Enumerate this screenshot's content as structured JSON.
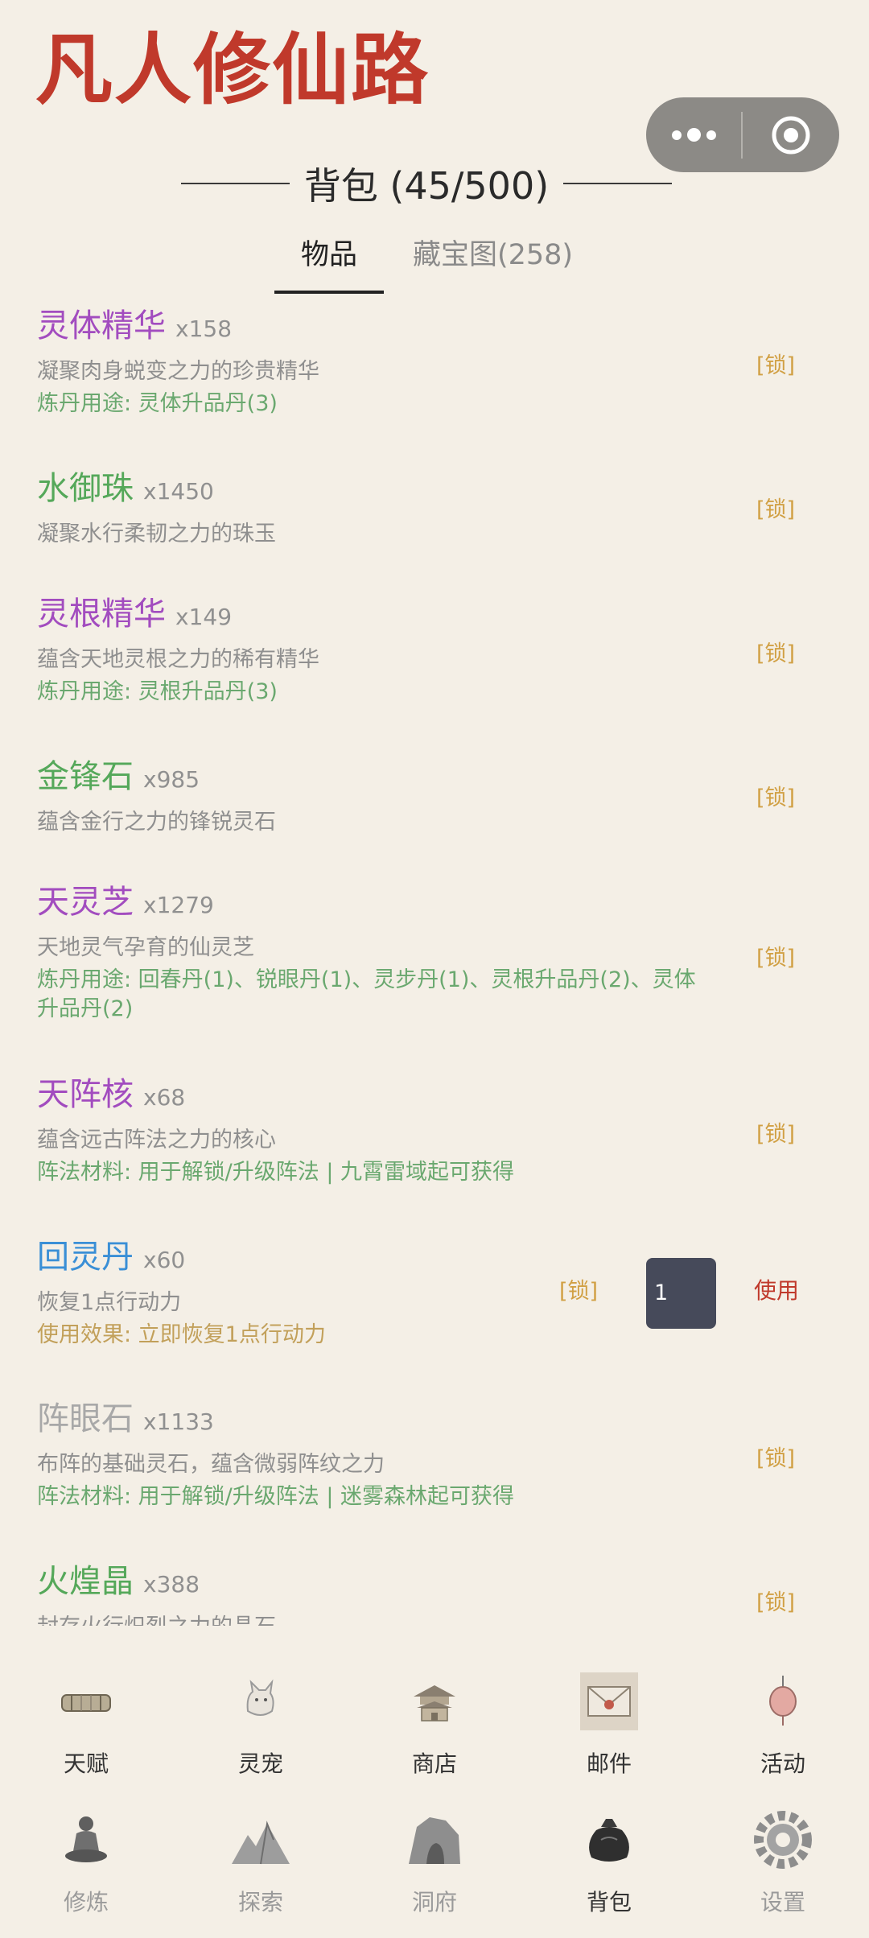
{
  "app": {
    "title": "凡人修仙路"
  },
  "header": {
    "section_title": "背包 (45/500)"
  },
  "tabs": [
    {
      "label": "物品",
      "active": true
    },
    {
      "label": "藏宝图(258)",
      "active": false
    }
  ],
  "items": [
    {
      "name": "灵体精华",
      "color": "#a24cbf",
      "count": "x158",
      "desc": "凝聚肉身蜕变之力的珍贵精华",
      "extra": "炼丹用途: 灵体升品丹(3)",
      "lock": "[锁]"
    },
    {
      "name": "水御珠",
      "color": "#55a85a",
      "count": "x1450",
      "desc": "凝聚水行柔韧之力的珠玉",
      "extra": "",
      "lock": "[锁]"
    },
    {
      "name": "灵根精华",
      "color": "#a24cbf",
      "count": "x149",
      "desc": "蕴含天地灵根之力的稀有精华",
      "extra": "炼丹用途: 灵根升品丹(3)",
      "lock": "[锁]"
    },
    {
      "name": "金锋石",
      "color": "#55a85a",
      "count": "x985",
      "desc": "蕴含金行之力的锋锐灵石",
      "extra": "",
      "lock": "[锁]"
    },
    {
      "name": "天灵芝",
      "color": "#a24cbf",
      "count": "x1279",
      "desc": "天地灵气孕育的仙灵芝",
      "extra": "炼丹用途: 回春丹(1)、锐眼丹(1)、灵步丹(1)、灵根升品丹(2)、灵体升品丹(2)",
      "lock": "[锁]"
    },
    {
      "name": "天阵核",
      "color": "#a24cbf",
      "count": "x68",
      "desc": "蕴含远古阵法之力的核心",
      "extra": "阵法材料: 用于解锁/升级阵法 | 九霄雷域起可获得",
      "lock": "[锁]"
    },
    {
      "name": "回灵丹",
      "color": "#3a8fd6",
      "count": "x60",
      "desc": "恢复1点行动力",
      "extra": "使用效果: 立即恢复1点行动力",
      "lock": "[锁]",
      "quantity": "1",
      "use_label": "使用"
    },
    {
      "name": "阵眼石",
      "color": "#a8a8a8",
      "count": "x1133",
      "desc": "布阵的基础灵石，蕴含微弱阵纹之力",
      "extra": "阵法材料: 用于解锁/升级阵法 | 迷雾森林起可获得",
      "lock": "[锁]"
    },
    {
      "name": "火煌晶",
      "color": "#55a85a",
      "count": "x388",
      "desc": "封存火行炽烈之力的晶石",
      "extra": "",
      "lock": "[锁]"
    }
  ],
  "nav_row1": [
    {
      "label": "天赋",
      "icon": "scroll-icon"
    },
    {
      "label": "灵宠",
      "icon": "fox-icon"
    },
    {
      "label": "商店",
      "icon": "pavilion-icon"
    },
    {
      "label": "邮件",
      "icon": "envelope-icon"
    },
    {
      "label": "活动",
      "icon": "lantern-icon"
    }
  ],
  "nav_row2": [
    {
      "label": "修炼",
      "icon": "meditation-icon"
    },
    {
      "label": "探索",
      "icon": "mountain-icon"
    },
    {
      "label": "洞府",
      "icon": "cave-icon"
    },
    {
      "label": "背包",
      "icon": "bag-icon",
      "active": true
    },
    {
      "label": "设置",
      "icon": "gear-icon"
    }
  ]
}
